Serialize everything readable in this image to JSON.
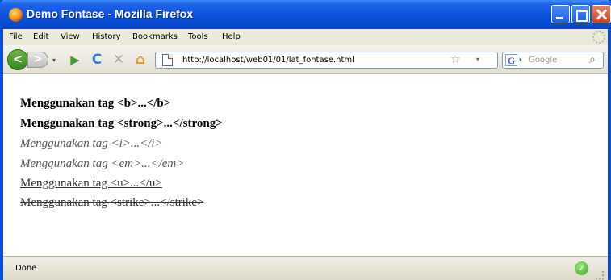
{
  "window": {
    "title": "Demo Fontase - Mozilla Firefox"
  },
  "menu": {
    "items": [
      {
        "label": "File"
      },
      {
        "label": "Edit"
      },
      {
        "label": "View"
      },
      {
        "label": "History"
      },
      {
        "label": "Bookmarks"
      },
      {
        "label": "Tools"
      },
      {
        "label": "Help"
      }
    ]
  },
  "nav": {
    "back_glyph": "<",
    "forward_glyph": ">",
    "dropdown_glyph": "▾",
    "reload_glyph": "C",
    "stop_glyph": "✕",
    "home_glyph": "⌂",
    "url": "http://localhost/web01/01/lat_fontase.html",
    "star_glyph": "☆"
  },
  "search": {
    "engine_glyph": "G",
    "placeholder": "Google",
    "magnifier_glyph": "⌕"
  },
  "content": {
    "lines": [
      {
        "text": "Menggunakan tag <b>...</b>",
        "style": "bold"
      },
      {
        "text": "Menggunakan tag <strong>...</strong>",
        "style": "bold"
      },
      {
        "text": "Menggunakan tag <i>...</i>",
        "style": "italic"
      },
      {
        "text": "Menggunakan tag <em>...</em>",
        "style": "italic"
      },
      {
        "text": "Menggunakan tag <u>...</u>",
        "style": "underline"
      },
      {
        "text": "Menggunakan tag <strike>...</strike>",
        "style": "strikethrough"
      }
    ]
  },
  "status": {
    "text": "Done",
    "check_glyph": "✓"
  },
  "colors": {
    "titlebar": "#0a52dc",
    "chrome": "#ece9d8"
  }
}
